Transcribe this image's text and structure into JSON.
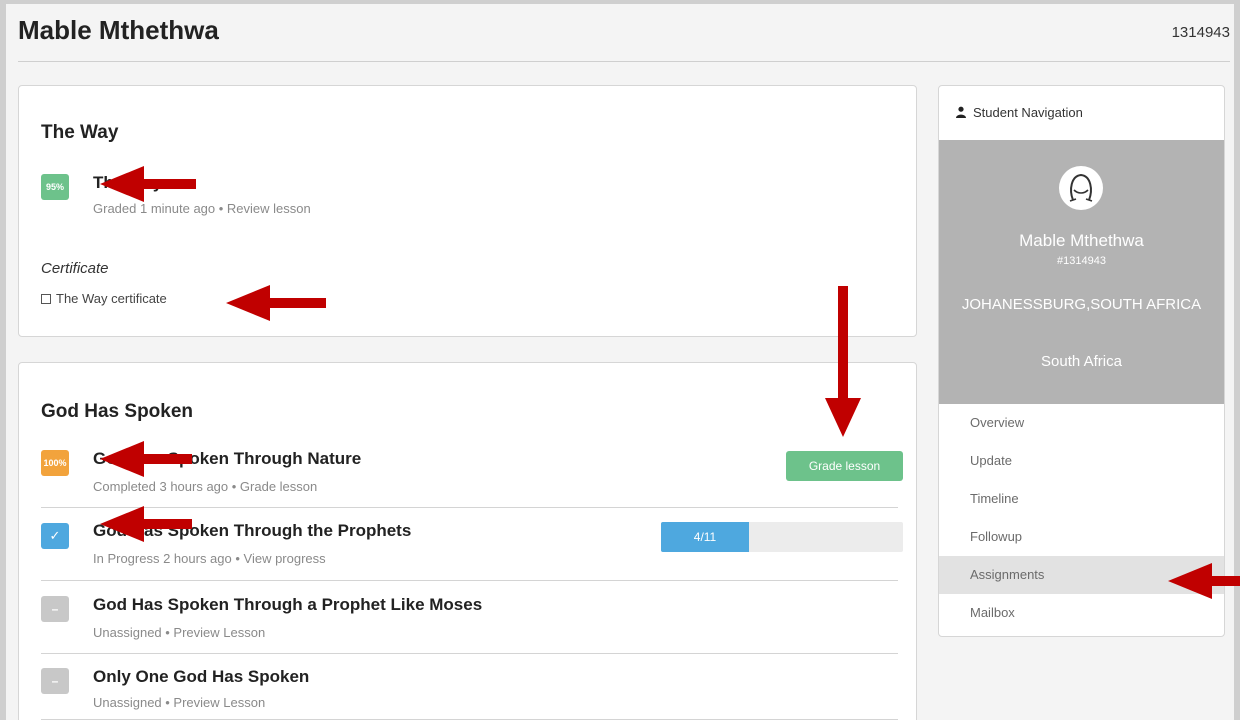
{
  "header": {
    "name": "Mable Mthethwa",
    "id": "1314943"
  },
  "course1": {
    "title": "The Way",
    "lesson": {
      "badge": "95%",
      "title": "The Way",
      "sub": "Graded 1 minute ago • Review lesson"
    },
    "certificate_heading": "Certificate",
    "certificate_link": "The Way certificate"
  },
  "course2": {
    "title": "God Has Spoken",
    "lessons": [
      {
        "badge": "100%",
        "title": "God Has Spoken Through Nature",
        "sub": "Completed 3 hours ago • Grade lesson",
        "action": "Grade lesson"
      },
      {
        "badge": "✓",
        "title": "God Has Spoken Through the Prophets",
        "sub": "In Progress 2 hours ago • View progress",
        "progress_text": "4/11",
        "progress_fraction": 0.364
      },
      {
        "badge": "–",
        "title": "God Has Spoken Through a Prophet Like Moses",
        "sub": "Unassigned • Preview Lesson"
      },
      {
        "badge": "–",
        "title": "Only One God Has Spoken",
        "sub": "Unassigned • Preview Lesson"
      }
    ]
  },
  "sidebar": {
    "heading": "Student Navigation",
    "profile": {
      "name": "Mable Mthethwa",
      "id": "#1314943",
      "city": "JOHANESSBURG,SOUTH AFRICA",
      "country": "South Africa"
    },
    "nav": [
      "Overview",
      "Update",
      "Timeline",
      "Followup",
      "Assignments",
      "Mailbox"
    ],
    "active_nav": "Assignments"
  },
  "colors": {
    "grade_green": "#6dc28b",
    "complete_orange": "#f2a33c",
    "progress_blue": "#4ea8df",
    "unassigned_gray": "#c8c8c8",
    "annotation_red": "#c00000"
  }
}
